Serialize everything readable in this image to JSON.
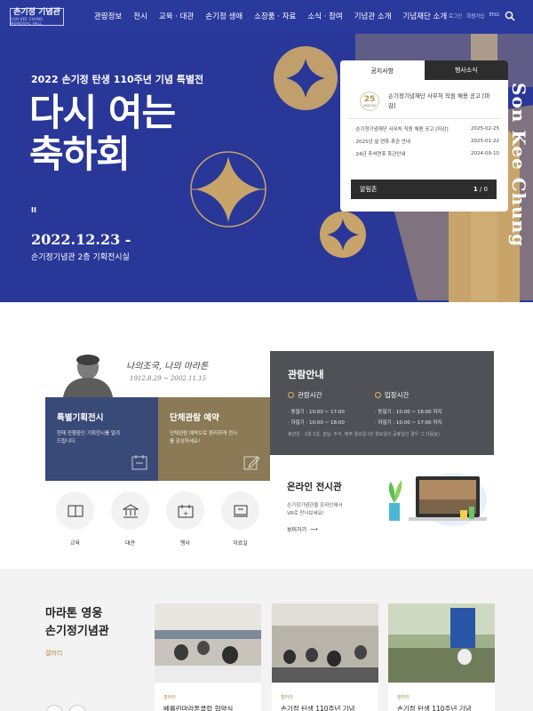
{
  "header": {
    "logo_text": "손기정 기념관",
    "logo_sub": "SON KEE CHUNG MEMORIAL HALL",
    "nav": [
      "관람정보",
      "전시",
      "교육 · 대관",
      "손기정 생애",
      "소장품 · 자료",
      "소식 · 참여",
      "기념관 소개",
      "기념재단 소개"
    ],
    "util": [
      "로그인",
      "회원가입",
      "ENG"
    ],
    "search_icon": "search-icon"
  },
  "hero": {
    "subtitle": "2022 손기정 탄생 110주년 기념 특별전",
    "title_line1": "다시 여는",
    "title_line2": "축하회",
    "pause_label": "II",
    "date": "2022.12.23 -",
    "place": "손기정기념관 2층 기획전시실",
    "vertical_text": "Son Kee Chung",
    "colors": {
      "bg": "#293798",
      "gold": "#c9a46a"
    }
  },
  "notice": {
    "tabs": [
      "공지사항",
      "행사소식"
    ],
    "featured": {
      "day": "25",
      "month": "2025.02",
      "title": "손기정기념재단 사무처 직원 채용 공고 [마감]"
    },
    "items": [
      {
        "title": "손기정기념재단 사무처 직원 채용 공고 [마감]",
        "date": "2025-02-25"
      },
      {
        "title": "2025년 설 연휴 휴관 안내",
        "date": "2025-01-22"
      },
      {
        "title": "24년 추석연휴 휴관안내",
        "date": "2024-09-10"
      }
    ],
    "alarm_label": "알림존",
    "page_current": "1",
    "page_total": "/ 0"
  },
  "intro": {
    "signature": "나의조국, 나의 마라톤",
    "dates": "1912.8.29 ~ 2002.11.15"
  },
  "cards": [
    {
      "title": "특별기획전시",
      "desc": "현재 진행중인 기획전시를 알려드립니다."
    },
    {
      "title": "단체관람 예약",
      "desc": "단체관람 예약으로 편리하게 전시를 감상하세요!"
    }
  ],
  "guide": {
    "title": "관람안내",
    "hours_title": "관람시간",
    "hours": [
      "동절기 : 10:00 ~ 17:00",
      "하절기 : 10:00 ~ 18:00"
    ],
    "entry_title": "입장시간",
    "entry": [
      "동절기 : 10:00 ~ 16:00 까지",
      "하절기 : 10:00 ~ 17:00 까지"
    ],
    "note": "휴관일 : 1월 1일, 설날, 추석, 매주 월요일 (단 월요일이 공휴일인 경우 그 다음날)"
  },
  "online": {
    "title": "온라인 전시관",
    "desc1": "손기정기념관을 온라인에서",
    "desc2": "VR로 만나보세요!",
    "more": "보러가기"
  },
  "quick": [
    {
      "label": "교육",
      "icon": "book-icon"
    },
    {
      "label": "대관",
      "icon": "building-icon"
    },
    {
      "label": "행사",
      "icon": "calendar-icon"
    },
    {
      "label": "자료실",
      "icon": "archive-icon"
    }
  ],
  "gallery": {
    "title_line1": "마라톤 영웅",
    "title_line2": "손기정기념관",
    "link": "갤러리",
    "items": [
      {
        "category": "갤러리",
        "title": "베를린마라톤클럽 협약식"
      },
      {
        "category": "갤러리",
        "title": "손기정 탄생 110주년 기념"
      },
      {
        "category": "갤러리",
        "title": "손기정 탄생 110주년 기념"
      }
    ]
  }
}
